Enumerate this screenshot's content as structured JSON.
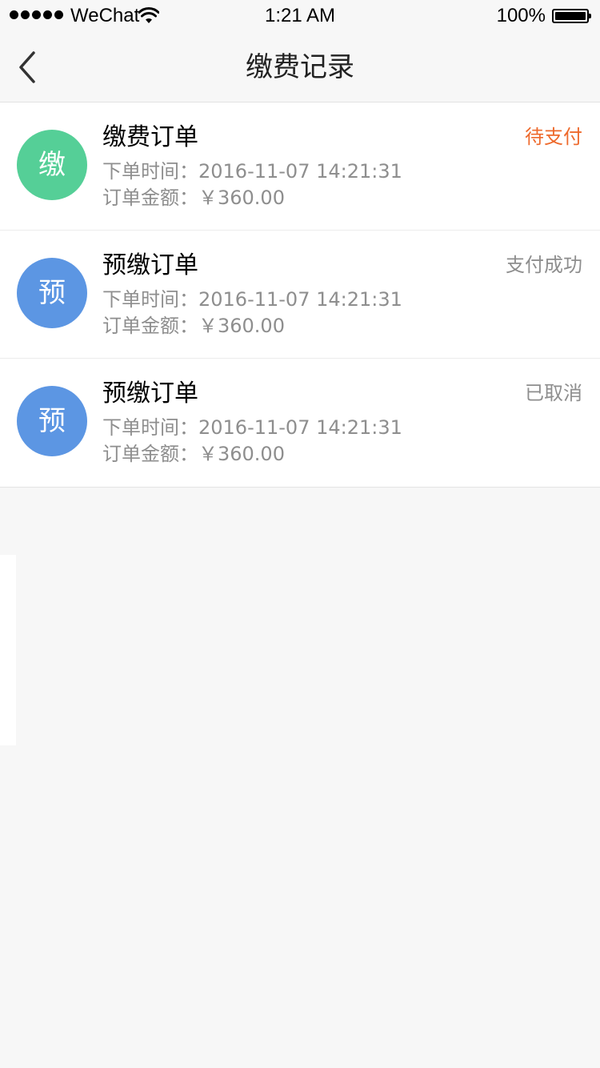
{
  "status_bar": {
    "carrier": "WeChat",
    "time": "1:21 AM",
    "battery": "100%"
  },
  "nav": {
    "title": "缴费记录",
    "back_icon": "chevron-left-icon"
  },
  "colors": {
    "pending": "#ee6a2c",
    "muted_status": "#8e8e8e",
    "avatar_green": "#55cf97",
    "avatar_blue": "#5c96e3"
  },
  "orders": [
    {
      "avatar_char": "缴",
      "avatar_color": "#55cf97",
      "title": "缴费订单",
      "status": "待支付",
      "status_color": "#ee6a2c",
      "time_text": "下单时间：2016-11-07 14:21:31",
      "amount_text": "订单金额：￥360.00"
    },
    {
      "avatar_char": "预",
      "avatar_color": "#5c96e3",
      "title": "预缴订单",
      "status": "支付成功",
      "status_color": "#8e8e8e",
      "time_text": "下单时间：2016-11-07 14:21:31",
      "amount_text": "订单金额：￥360.00"
    },
    {
      "avatar_char": "预",
      "avatar_color": "#5c96e3",
      "title": "预缴订单",
      "status": "已取消",
      "status_color": "#8e8e8e",
      "time_text": "下单时间：2016-11-07 14:21:31",
      "amount_text": "订单金额：￥360.00"
    }
  ]
}
